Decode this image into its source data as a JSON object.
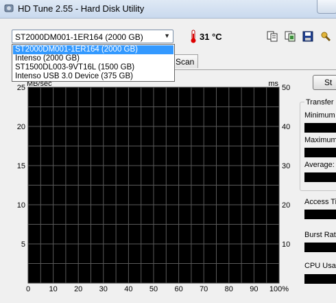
{
  "window": {
    "title": "HD Tune 2.55 - Hard Disk Utility"
  },
  "drive": {
    "selected": "ST2000DM001-1ER164 (2000 GB)",
    "options": [
      "ST2000DM001-1ER164 (2000 GB)",
      "Intenso  (2000 GB)",
      "ST1500DL003-9VT16L (1500 GB)",
      "Intenso  USB 3.0 Device (375 GB)"
    ]
  },
  "temperature": "31 °C",
  "toolbar": {
    "icons": [
      "copy-text-icon",
      "copy-screenshot-icon",
      "save-icon",
      "options-icon"
    ]
  },
  "tabs": {
    "visible_partial": "Scan"
  },
  "start_button": {
    "label": "St"
  },
  "stats": {
    "group_title": "Transfer R",
    "minimum": "Minimum",
    "maximum": "Maximum",
    "average": "Average:",
    "access_time": "Access Ti",
    "burst_rate": "Burst Rate",
    "cpu_usage": "CPU Usag"
  },
  "chart_data": {
    "type": "line",
    "left_axis_label": "MB/sec",
    "right_axis_label": "ms",
    "y_left_ticks": [
      "25",
      "20",
      "15",
      "10",
      "5"
    ],
    "y_right_ticks": [
      "50",
      "40",
      "30",
      "20",
      "10"
    ],
    "x_ticks": [
      "0",
      "10",
      "20",
      "30",
      "40",
      "50",
      "60",
      "70",
      "80",
      "90",
      "100%"
    ],
    "y_left_range": [
      0,
      25
    ],
    "y_right_range": [
      0,
      50
    ],
    "x_range": [
      0,
      100
    ],
    "grid": true,
    "series": []
  }
}
